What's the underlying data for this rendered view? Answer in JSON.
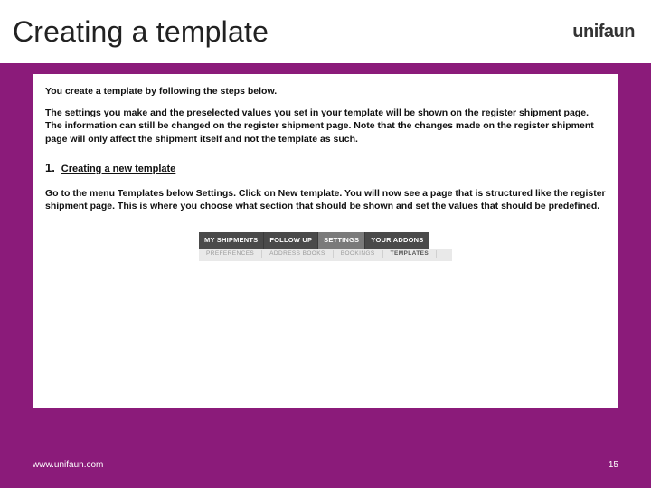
{
  "header": {
    "title": "Creating a template",
    "brand": "unifaun"
  },
  "body": {
    "intro": "You create a template by following the steps below.",
    "explain": "The settings you make and the preselected values you set in your template will be shown on the register shipment page. The information can still be changed on the register shipment page. Note that the changes made on the register shipment page will only affect the shipment itself and not the template as such.",
    "step_num": "1.",
    "step_title": "Creating a new template",
    "step_body": "Go to the menu Templates below Settings. Click on New template.  You will now see a page that is structured like the register shipment page. This is where you choose what section that should be shown and set the values that should be predefined."
  },
  "menus": {
    "tabs": [
      "MY SHIPMENTS",
      "FOLLOW UP",
      "SETTINGS",
      "YOUR ADDONS"
    ],
    "active_tab_index": 2,
    "subtabs": [
      "PREFERENCES",
      "ADDRESS BOOKS",
      "BOOKINGS",
      "TEMPLATES"
    ],
    "active_subtab_index": 3
  },
  "footer": {
    "url": "www.unifaun.com",
    "page": "15"
  }
}
